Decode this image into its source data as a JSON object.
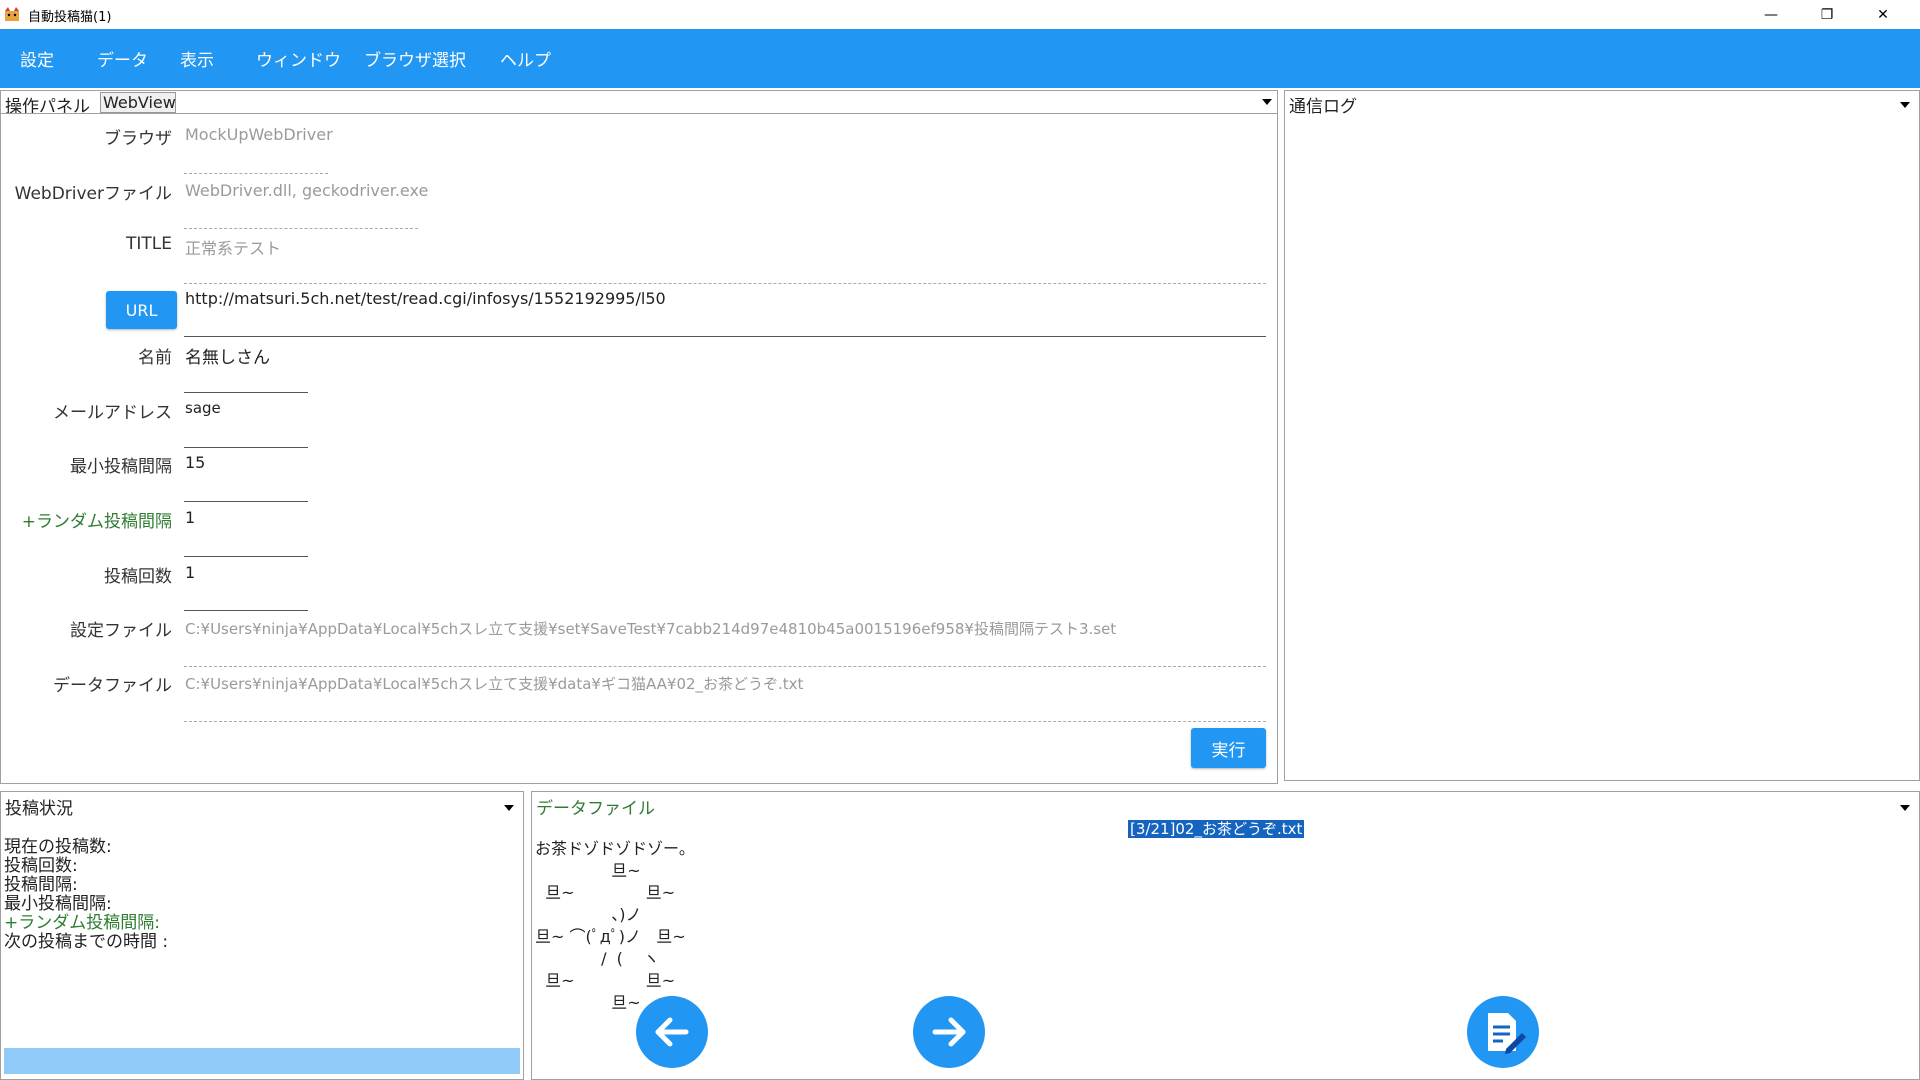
{
  "window": {
    "title": "自動投稿猫(1)",
    "controls": {
      "minimize": "—",
      "restore": "❐",
      "close": "✕"
    }
  },
  "menu": {
    "items": [
      "設定",
      "データ",
      "表示",
      "ウィンドウ",
      "ブラウザ選択",
      "ヘルプ"
    ]
  },
  "control_panel": {
    "title": "操作パネル",
    "tab": "WebView",
    "fields": {
      "browser": {
        "label": "ブラウザ",
        "value": "MockUpWebDriver"
      },
      "webdriver": {
        "label": "WebDriverファイル",
        "value": "WebDriver.dll, geckodriver.exe"
      },
      "title": {
        "label": "TITLE",
        "value": "正常系テスト"
      },
      "url": {
        "label": "URL",
        "value": "http://matsuri.5ch.net/test/read.cgi/infosys/1552192995/l50"
      },
      "name": {
        "label": "名前",
        "value": "名無しさん"
      },
      "email": {
        "label": "メールアドレス",
        "value": "sage"
      },
      "min_interval": {
        "label": "最小投稿間隔",
        "value": "15"
      },
      "random_interval": {
        "label": "+ランダム投稿間隔",
        "value": "1"
      },
      "post_count": {
        "label": "投稿回数",
        "value": "1"
      },
      "settings_file": {
        "label": "設定ファイル",
        "value": "C:¥Users¥ninja¥AppData¥Local¥5chスレ立て支援¥set¥SaveTest¥7cabb214d97e4810b45a0015196ef958¥投稿間隔テスト3.set"
      },
      "data_file": {
        "label": "データファイル",
        "value": "C:¥Users¥ninja¥AppData¥Local¥5chスレ立て支援¥data¥ギコ猫AA¥02_お茶どうぞ.txt"
      }
    },
    "run_button": "実行"
  },
  "comm_log": {
    "title": "通信ログ"
  },
  "post_status": {
    "title": "投稿状況",
    "lines": [
      "現在の投稿数:",
      "投稿回数:",
      "投稿間隔:",
      "最小投稿間隔:",
      "+ランダム投稿間隔:",
      "次の投稿までの時間 :"
    ],
    "progress": 1.0
  },
  "data_file_panel": {
    "title": "データファイル",
    "filename": "[3/21]02_お茶どうぞ.txt",
    "content": "お茶ドゾドゾドゾー。\n               旦~\n  旦~              旦~\n               、)ノ\n旦~ ⌒(ﾟдﾟ)ノ   旦~\n             /  (    ヽ\n  旦~              旦~\n               旦~",
    "buttons": [
      "back-arrow-icon",
      "forward-arrow-icon",
      "edit-document-icon"
    ]
  },
  "colors": {
    "accent": "#2196f3",
    "progress": "#90caf9",
    "badge": "#1565c0"
  }
}
